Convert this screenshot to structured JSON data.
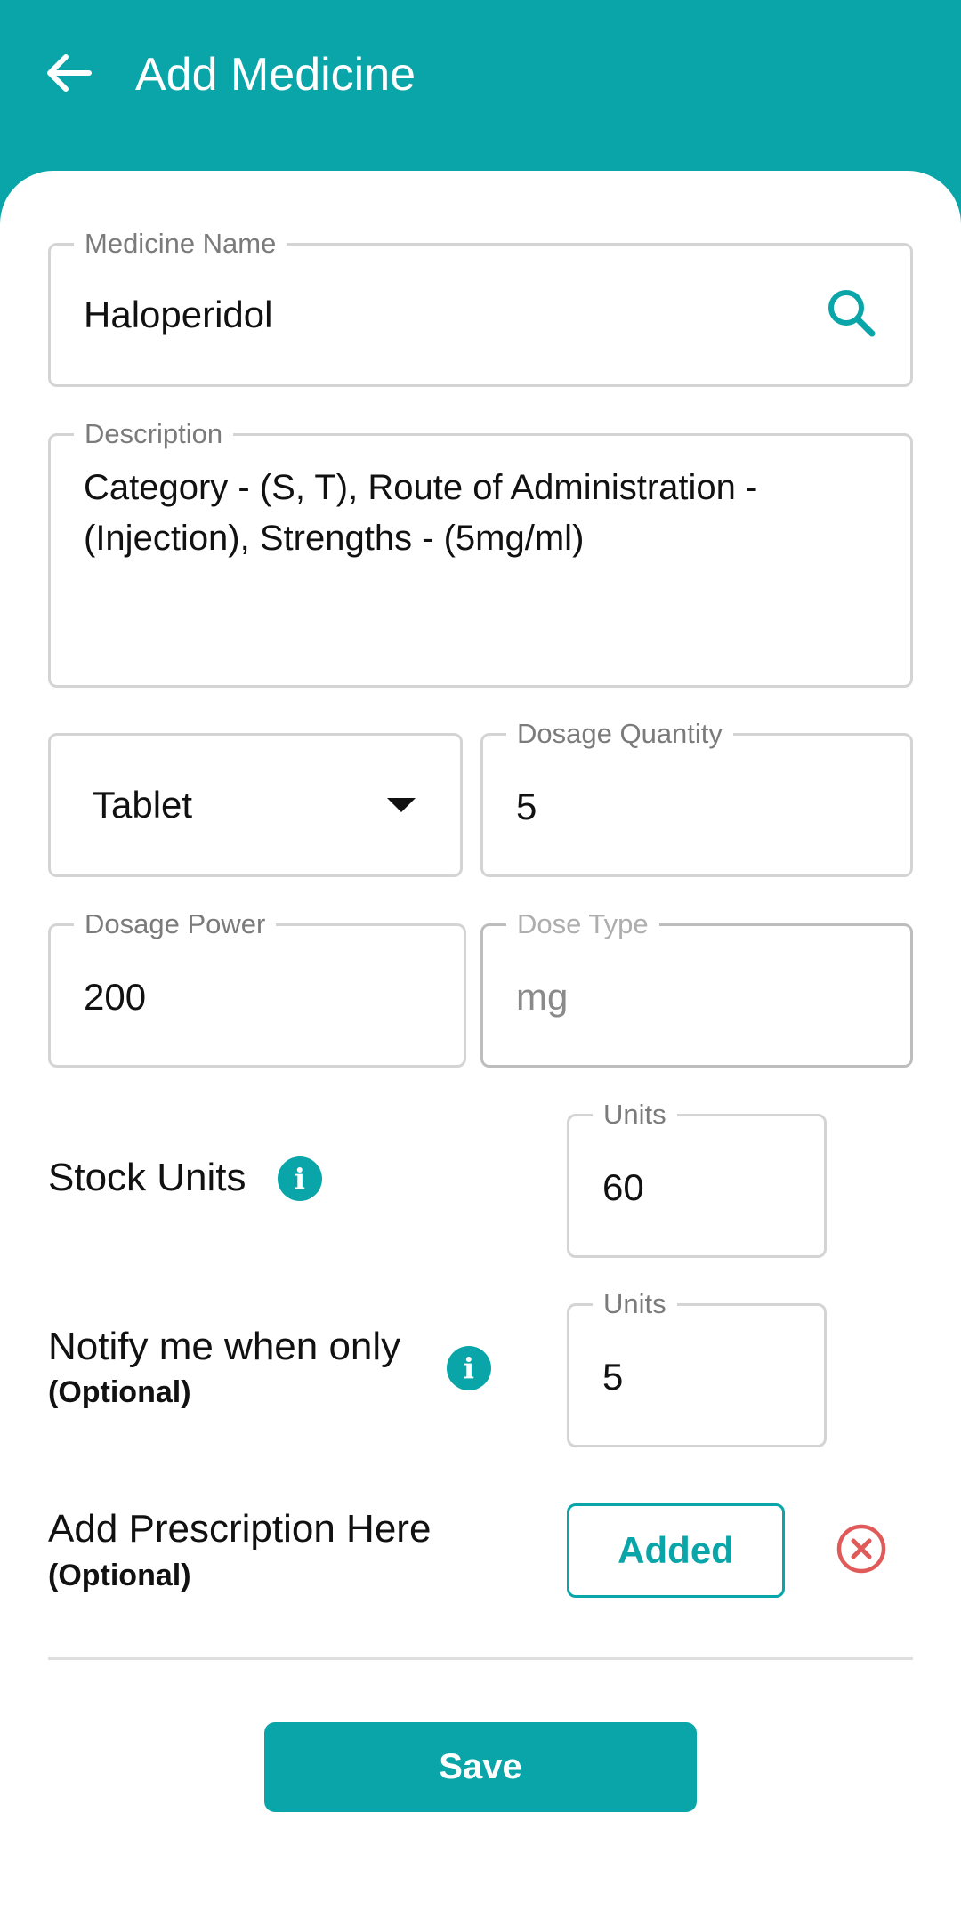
{
  "header": {
    "title": "Add Medicine"
  },
  "form": {
    "medicine_name": {
      "label": "Medicine Name",
      "value": "Haloperidol"
    },
    "description": {
      "label": "Description",
      "value": "Category - (S, T), Route of Administration - (Injection), Strengths - (5mg/ml)"
    },
    "form_type": {
      "selected": "Tablet"
    },
    "dosage_quantity": {
      "label": "Dosage Quantity",
      "value": "5"
    },
    "dosage_power": {
      "label": "Dosage Power",
      "value": "200"
    },
    "dose_type": {
      "label": "Dose Type",
      "value": "mg"
    },
    "stock_units": {
      "label": "Stock Units",
      "field_label": "Units",
      "value": "60"
    },
    "notify": {
      "label": "Notify me when only",
      "optional": "(Optional)",
      "field_label": "Units",
      "value": "5"
    },
    "prescription": {
      "label": "Add Prescription Here",
      "optional": "(Optional)",
      "button_label": "Added"
    }
  },
  "actions": {
    "save_label": "Save"
  },
  "icons": {
    "back": "arrow-left-icon",
    "search": "search-icon",
    "dropdown": "chevron-down-icon",
    "info": "info-icon",
    "remove": "close-circle-icon"
  },
  "colors": {
    "primary": "#0aa5a8",
    "danger": "#e05a5a",
    "text": "#111111",
    "muted": "#7b7b7b",
    "border": "#d4d4d4"
  }
}
